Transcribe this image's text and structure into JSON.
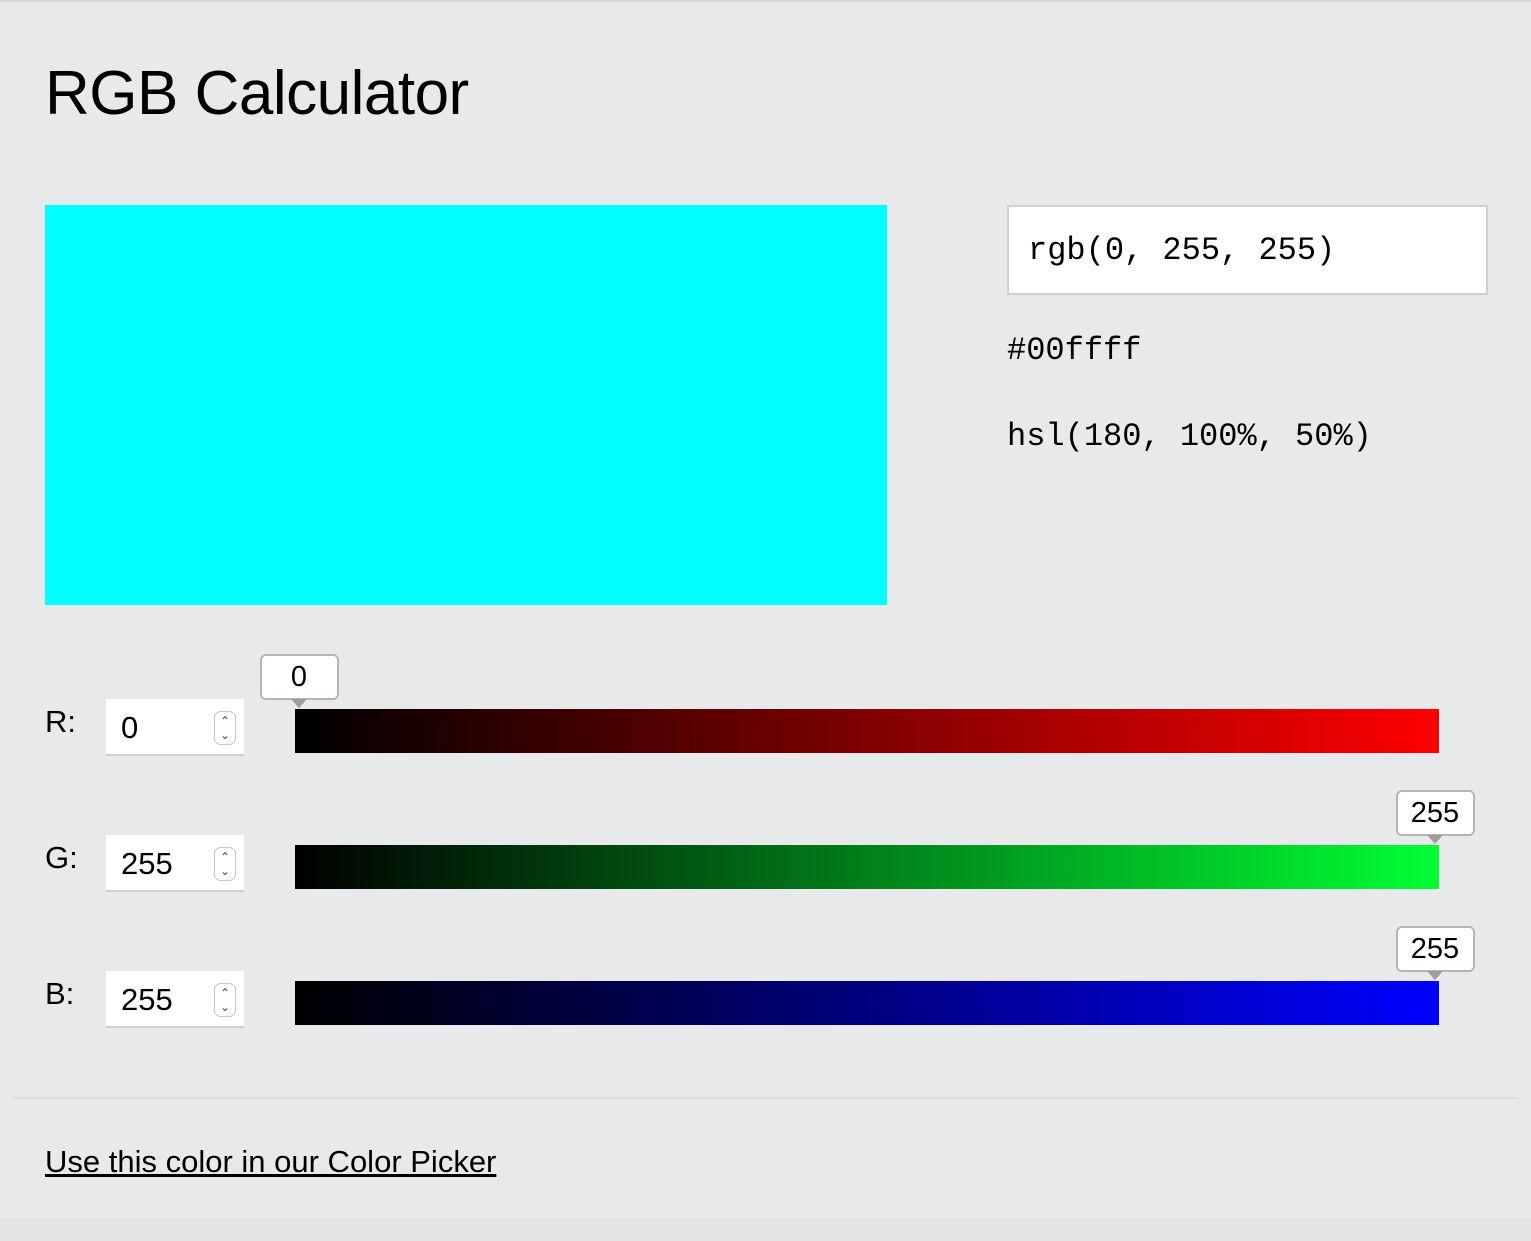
{
  "title": "RGB Calculator",
  "color": {
    "rgb": "rgb(0, 255, 255)",
    "hex": "#00ffff",
    "hsl": "hsl(180, 100%, 50%)",
    "swatch": "#00ffff"
  },
  "channels": [
    {
      "label": "R:",
      "value": "0",
      "bubble": "0",
      "level": 0
    },
    {
      "label": "G:",
      "value": "255",
      "bubble": "255",
      "level": 255
    },
    {
      "label": "B:",
      "value": "255",
      "bubble": "255",
      "level": 255
    }
  ],
  "slider_max": 255,
  "icons": {
    "spinner_up": "chevron-up-icon",
    "spinner_down": "chevron-down-icon"
  },
  "link_text": "Use this color in our Color Picker"
}
